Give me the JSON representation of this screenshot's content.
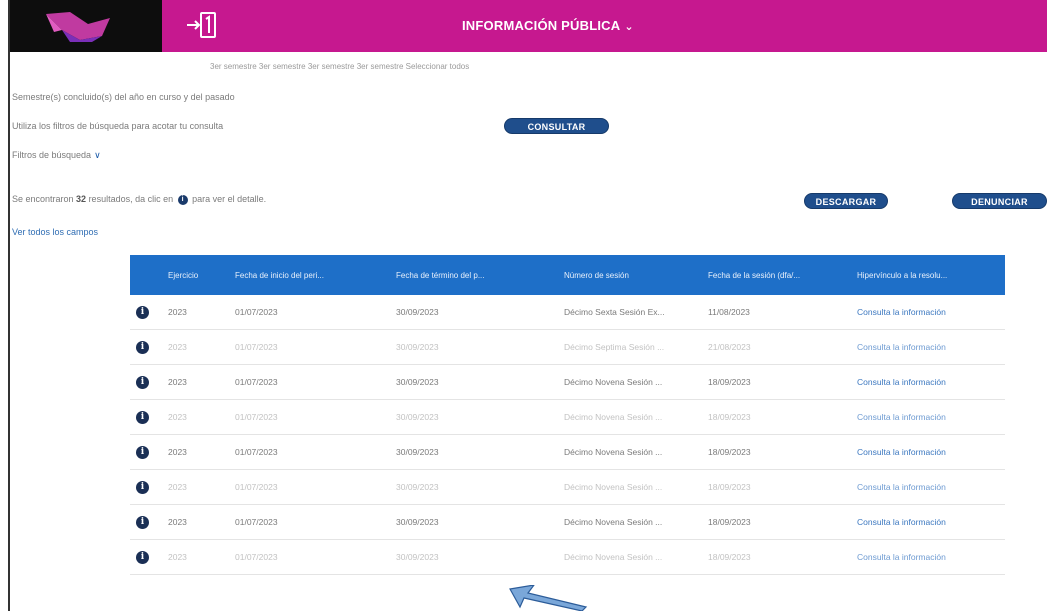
{
  "header": {
    "title": "INFORMACIÓN PÚBLICA",
    "brand_color": "#c6188f"
  },
  "filters": {
    "semester_options": "3er semestre   3er semestre   3er semestre   3er semestre   Seleccionar todos",
    "semester_note": "Semestre(s) concluido(s) del año en curso y del pasado",
    "hint": "Utiliza los filtros de búsqueda para acotar tu consulta",
    "consult_label": "CONSULTAR",
    "search_filters_label": "Filtros de búsqueda"
  },
  "results": {
    "prefix": "Se encontraron ",
    "count": "32",
    "middle": " resultados, da clic en ",
    "suffix": " para ver el detalle.",
    "download_label": "DESCARGAR",
    "report_label": "DENUNCIAR",
    "all_fields_label": "Ver todos los campos"
  },
  "table": {
    "header_color": "#1e6fc8",
    "columns": [
      "Ejercicio",
      "Fecha de inicio del peri...",
      "Fecha de término del p...",
      "Número de sesión",
      "Fecha de la sesión (dfa/...",
      "Hipervínculo a la resolu..."
    ],
    "rows": [
      {
        "ejercicio": "2023",
        "inicio": "01/07/2023",
        "termino": "30/09/2023",
        "sesion": "Décimo Sexta Sesión Ex...",
        "fecha": "11/08/2023",
        "link": "Consulta la información",
        "tone": "dark"
      },
      {
        "ejercicio": "2023",
        "inicio": "01/07/2023",
        "termino": "30/09/2023",
        "sesion": "Décimo Septima Sesión ...",
        "fecha": "21/08/2023",
        "link": "Consulta la información",
        "tone": "light"
      },
      {
        "ejercicio": "2023",
        "inicio": "01/07/2023",
        "termino": "30/09/2023",
        "sesion": "Décimo Novena Sesión ...",
        "fecha": "18/09/2023",
        "link": "Consulta la información",
        "tone": "dark"
      },
      {
        "ejercicio": "2023",
        "inicio": "01/07/2023",
        "termino": "30/09/2023",
        "sesion": "Décimo Novena Sesión ...",
        "fecha": "18/09/2023",
        "link": "Consulta la información",
        "tone": "light"
      },
      {
        "ejercicio": "2023",
        "inicio": "01/07/2023",
        "termino": "30/09/2023",
        "sesion": "Décimo Novena Sesión ...",
        "fecha": "18/09/2023",
        "link": "Consulta la información",
        "tone": "dark"
      },
      {
        "ejercicio": "2023",
        "inicio": "01/07/2023",
        "termino": "30/09/2023",
        "sesion": "Décimo Novena Sesión ...",
        "fecha": "18/09/2023",
        "link": "Consulta la información",
        "tone": "light"
      },
      {
        "ejercicio": "2023",
        "inicio": "01/07/2023",
        "termino": "30/09/2023",
        "sesion": "Décimo Novena Sesión ...",
        "fecha": "18/09/2023",
        "link": "Consulta la información",
        "tone": "dark"
      },
      {
        "ejercicio": "2023",
        "inicio": "01/07/2023",
        "termino": "30/09/2023",
        "sesion": "Décimo Novena Sesión ...",
        "fecha": "18/09/2023",
        "link": "Consulta la información",
        "tone": "light"
      }
    ]
  },
  "icons": {
    "logo": "logo-mark",
    "login": "login-arrow-icon",
    "info": "info-icon",
    "annotation": "pointer-arrow-icon"
  }
}
